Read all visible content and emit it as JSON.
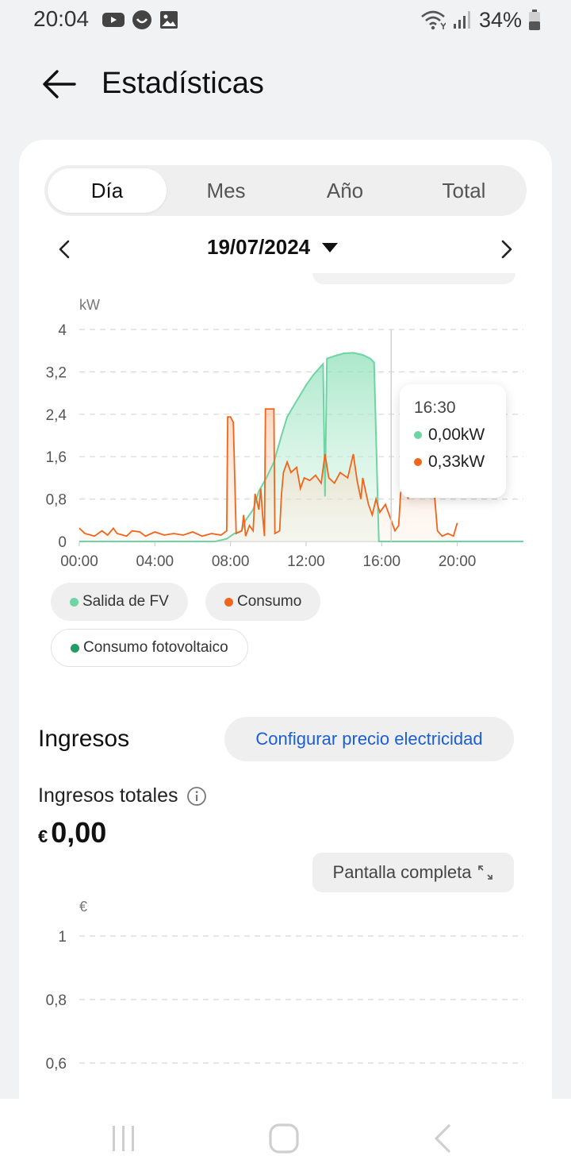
{
  "status": {
    "time": "20:04",
    "battery": "34%",
    "left_icons": [
      "youtube-icon",
      "app-icon",
      "image-icon"
    ],
    "right_icons": [
      "wifi-icon",
      "signal-icon",
      "battery-icon"
    ]
  },
  "header": {
    "title": "Estadísticas",
    "back_icon": "arrow-left-icon"
  },
  "tabs": [
    {
      "label": "Día",
      "active": true
    },
    {
      "label": "Mes",
      "active": false
    },
    {
      "label": "Año",
      "active": false
    },
    {
      "label": "Total",
      "active": false
    }
  ],
  "date": {
    "value": "19/07/2024",
    "prev_icon": "chevron-left-icon",
    "next_icon": "chevron-right-icon",
    "dropdown_icon": "caret-down-icon"
  },
  "chart_data": [
    {
      "type": "area",
      "ylabel": "kW",
      "ylim": [
        0,
        4
      ],
      "yticks": [
        "4",
        "3,2",
        "2,4",
        "1,6",
        "0,8",
        "0"
      ],
      "ytick_values": [
        4,
        3.2,
        2.4,
        1.6,
        0.8,
        0
      ],
      "xticks": [
        "00:00",
        "04:00",
        "08:00",
        "12:00",
        "16:00",
        "20:00"
      ],
      "x_unit": "hour",
      "xlim": [
        0,
        23.5
      ],
      "grid": true,
      "cursor_x": 16.5,
      "series": [
        {
          "name": "Salida de FV",
          "color": "#6fd4a4",
          "points": [
            [
              0,
              0
            ],
            [
              7.2,
              0
            ],
            [
              7.8,
              0.05
            ],
            [
              8.2,
              0.15
            ],
            [
              8.6,
              0.2
            ],
            [
              8.8,
              0.4
            ],
            [
              9.2,
              0.6
            ],
            [
              9.5,
              0.95
            ],
            [
              9.9,
              1.2
            ],
            [
              10.3,
              1.5
            ],
            [
              10.7,
              2.0
            ],
            [
              11.0,
              2.35
            ],
            [
              11.5,
              2.65
            ],
            [
              12.0,
              2.95
            ],
            [
              12.4,
              3.15
            ],
            [
              12.9,
              3.35
            ],
            [
              13.0,
              0.85
            ],
            [
              13.1,
              3.45
            ],
            [
              13.5,
              3.5
            ],
            [
              14.0,
              3.55
            ],
            [
              14.5,
              3.56
            ],
            [
              15.0,
              3.52
            ],
            [
              15.4,
              3.45
            ],
            [
              15.6,
              3.38
            ],
            [
              15.85,
              0
            ],
            [
              23.5,
              0
            ]
          ]
        },
        {
          "name": "Consumo",
          "color": "#f0651b",
          "points": [
            [
              0,
              0.25
            ],
            [
              0.3,
              0.15
            ],
            [
              0.8,
              0.1
            ],
            [
              1.2,
              0.2
            ],
            [
              1.5,
              0.12
            ],
            [
              1.8,
              0.25
            ],
            [
              2.0,
              0.15
            ],
            [
              2.5,
              0.1
            ],
            [
              2.8,
              0.2
            ],
            [
              3.2,
              0.18
            ],
            [
              3.5,
              0.1
            ],
            [
              4.0,
              0.18
            ],
            [
              4.5,
              0.12
            ],
            [
              5.0,
              0.15
            ],
            [
              5.5,
              0.12
            ],
            [
              6.0,
              0.18
            ],
            [
              6.5,
              0.1
            ],
            [
              7.0,
              0.15
            ],
            [
              7.5,
              0.12
            ],
            [
              7.8,
              0.2
            ],
            [
              7.85,
              2.35
            ],
            [
              8.0,
              2.35
            ],
            [
              8.15,
              2.25
            ],
            [
              8.3,
              0.15
            ],
            [
              8.6,
              0.2
            ],
            [
              8.7,
              0.5
            ],
            [
              8.8,
              0.1
            ],
            [
              9.0,
              0.3
            ],
            [
              9.2,
              0.2
            ],
            [
              9.3,
              0.9
            ],
            [
              9.5,
              0.6
            ],
            [
              9.6,
              1.0
            ],
            [
              9.7,
              0.5
            ],
            [
              9.8,
              0.1
            ],
            [
              9.85,
              2.5
            ],
            [
              10.3,
              2.5
            ],
            [
              10.35,
              0.15
            ],
            [
              10.6,
              0.2
            ],
            [
              10.7,
              0.9
            ],
            [
              10.8,
              1.3
            ],
            [
              11.0,
              1.5
            ],
            [
              11.2,
              1.3
            ],
            [
              11.5,
              1.4
            ],
            [
              11.7,
              1.0
            ],
            [
              11.9,
              1.2
            ],
            [
              12.2,
              1.15
            ],
            [
              12.5,
              1.25
            ],
            [
              12.8,
              1.1
            ],
            [
              13.0,
              1.65
            ],
            [
              13.2,
              1.2
            ],
            [
              13.5,
              1.1
            ],
            [
              13.8,
              1.3
            ],
            [
              14.2,
              1.2
            ],
            [
              14.5,
              1.65
            ],
            [
              14.7,
              1.15
            ],
            [
              14.9,
              0.8
            ],
            [
              15.0,
              1.2
            ],
            [
              15.3,
              0.7
            ],
            [
              15.5,
              0.5
            ],
            [
              15.7,
              0.8
            ],
            [
              15.9,
              0.55
            ],
            [
              16.2,
              0.7
            ],
            [
              16.5,
              0.4
            ],
            [
              16.7,
              0.2
            ],
            [
              16.9,
              0.3
            ],
            [
              17.0,
              0.9
            ],
            [
              17.2,
              1.2
            ],
            [
              17.4,
              0.8
            ],
            [
              17.6,
              1.1
            ],
            [
              17.9,
              0.85
            ],
            [
              18.2,
              0.9
            ],
            [
              18.5,
              1.0
            ],
            [
              18.8,
              0.85
            ],
            [
              18.95,
              0.2
            ],
            [
              19.2,
              0.1
            ],
            [
              19.5,
              0.15
            ],
            [
              19.8,
              0.1
            ],
            [
              20.0,
              0.35
            ]
          ]
        },
        {
          "name": "Consumo fotovoltaico",
          "color": "#1f9d64",
          "points": []
        }
      ]
    },
    {
      "type": "line",
      "ylabel": "€",
      "yticks": [
        "1",
        "0,8",
        "0,6"
      ],
      "ytick_values": [
        1,
        0.8,
        0.6
      ],
      "grid": true,
      "series": []
    }
  ],
  "tooltip": {
    "time": "16:30",
    "rows": [
      {
        "value": "0,00kW",
        "color": "#6fd4a4"
      },
      {
        "value": "0,33kW",
        "color": "#f0651b"
      }
    ]
  },
  "legend": [
    {
      "label": "Salida de FV",
      "color": "#6fd4a4"
    },
    {
      "label": "Consumo",
      "color": "#f0651b"
    },
    {
      "label": "Consumo fotovoltaico",
      "color": "#1f9d64"
    }
  ],
  "income": {
    "title": "Ingresos",
    "config_button": "Configurar precio electricidad",
    "total_label": "Ingresos totales",
    "currency": "€",
    "amount": "0,00",
    "fullscreen_button": "Pantalla completa"
  },
  "nav": {
    "icons": [
      "recents-icon",
      "home-icon",
      "back-icon"
    ]
  }
}
